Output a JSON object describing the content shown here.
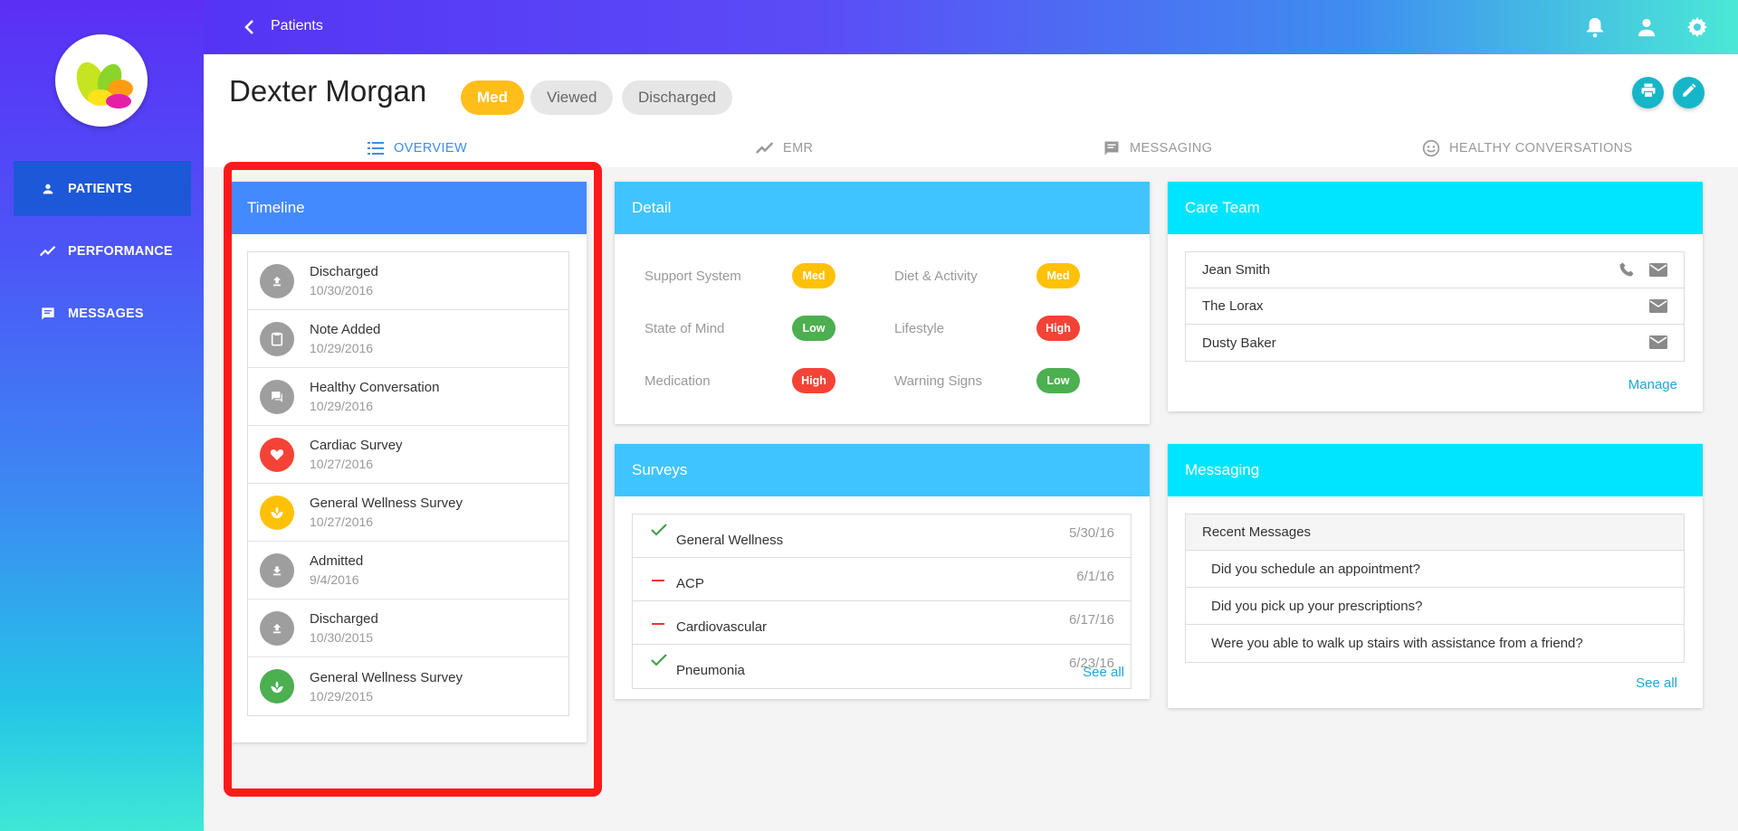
{
  "topbar": {
    "breadcrumb": "Patients",
    "icons": [
      "bell-icon",
      "user-icon",
      "gear-icon"
    ]
  },
  "sidebar": {
    "items": [
      {
        "label": "PATIENTS",
        "icon": "person-icon",
        "active": true
      },
      {
        "label": "PERFORMANCE",
        "icon": "trend-icon",
        "active": false
      },
      {
        "label": "MESSAGES",
        "icon": "message-icon",
        "active": false
      }
    ]
  },
  "patient": {
    "name": "Dexter Morgan",
    "chips": [
      "Med",
      "Viewed",
      "Discharged"
    ],
    "actions": [
      "print-icon",
      "edit-icon"
    ]
  },
  "tabs": [
    {
      "label": "OVERVIEW",
      "icon": "list-icon",
      "active": true
    },
    {
      "label": "EMR",
      "icon": "trend-icon"
    },
    {
      "label": "MESSAGING",
      "icon": "chat-icon"
    },
    {
      "label": "HEALTHY CONVERSATIONS",
      "icon": "smile-icon"
    }
  ],
  "timeline": {
    "title": "Timeline",
    "items": [
      {
        "title": "Discharged",
        "date": "10/30/2016",
        "icon": "upload-icon",
        "color": "#9e9e9e"
      },
      {
        "title": "Note Added",
        "date": "10/29/2016",
        "icon": "clipboard-icon",
        "color": "#9e9e9e"
      },
      {
        "title": "Healthy Conversation",
        "date": "10/29/2016",
        "icon": "chat-icon",
        "color": "#9e9e9e"
      },
      {
        "title": "Cardiac Survey",
        "date": "10/27/2016",
        "icon": "heart-icon",
        "color": "#f44336"
      },
      {
        "title": "General Wellness Survey",
        "date": "10/27/2016",
        "icon": "spa-icon",
        "color": "#ffc107"
      },
      {
        "title": "Admitted",
        "date": "9/4/2016",
        "icon": "download-icon",
        "color": "#9e9e9e"
      },
      {
        "title": "Discharged",
        "date": "10/30/2015",
        "icon": "upload-icon",
        "color": "#9e9e9e"
      },
      {
        "title": "General Wellness Survey",
        "date": "10/29/2015",
        "icon": "spa-icon",
        "color": "#4caf50"
      }
    ]
  },
  "detail": {
    "title": "Detail",
    "left": [
      {
        "label": "Support System",
        "level": "Med"
      },
      {
        "label": "State of Mind",
        "level": "Low"
      },
      {
        "label": "Medication",
        "level": "High"
      }
    ],
    "right": [
      {
        "label": "Diet & Activity",
        "level": "Med"
      },
      {
        "label": "Lifestyle",
        "level": "High"
      },
      {
        "label": "Warning Signs",
        "level": "Low"
      }
    ],
    "level_colors": {
      "Med": "#ffc107",
      "Low": "#4caf50",
      "High": "#f44336"
    }
  },
  "surveys": {
    "title": "Surveys",
    "items": [
      {
        "name": "General Wellness",
        "date": "5/30/16",
        "status": "check"
      },
      {
        "name": "ACP",
        "date": "6/1/16",
        "status": "dash"
      },
      {
        "name": "Cardiovascular",
        "date": "6/17/16",
        "status": "dash"
      },
      {
        "name": "Pneumonia",
        "date": "6/23/16",
        "status": "check"
      }
    ],
    "see_all": "See all"
  },
  "care_team": {
    "title": "Care Team",
    "members": [
      {
        "name": "Jean Smith",
        "phone": true
      },
      {
        "name": "The Lorax",
        "phone": false
      },
      {
        "name": "Dusty Baker",
        "phone": false
      }
    ],
    "manage": "Manage"
  },
  "messaging": {
    "title": "Messaging",
    "header": "Recent Messages",
    "items": [
      "Did you schedule an appointment?",
      "Did you pick up your prescriptions?",
      "Were you able to walk up stairs with assistance from a friend?"
    ],
    "see_all": "See all"
  }
}
